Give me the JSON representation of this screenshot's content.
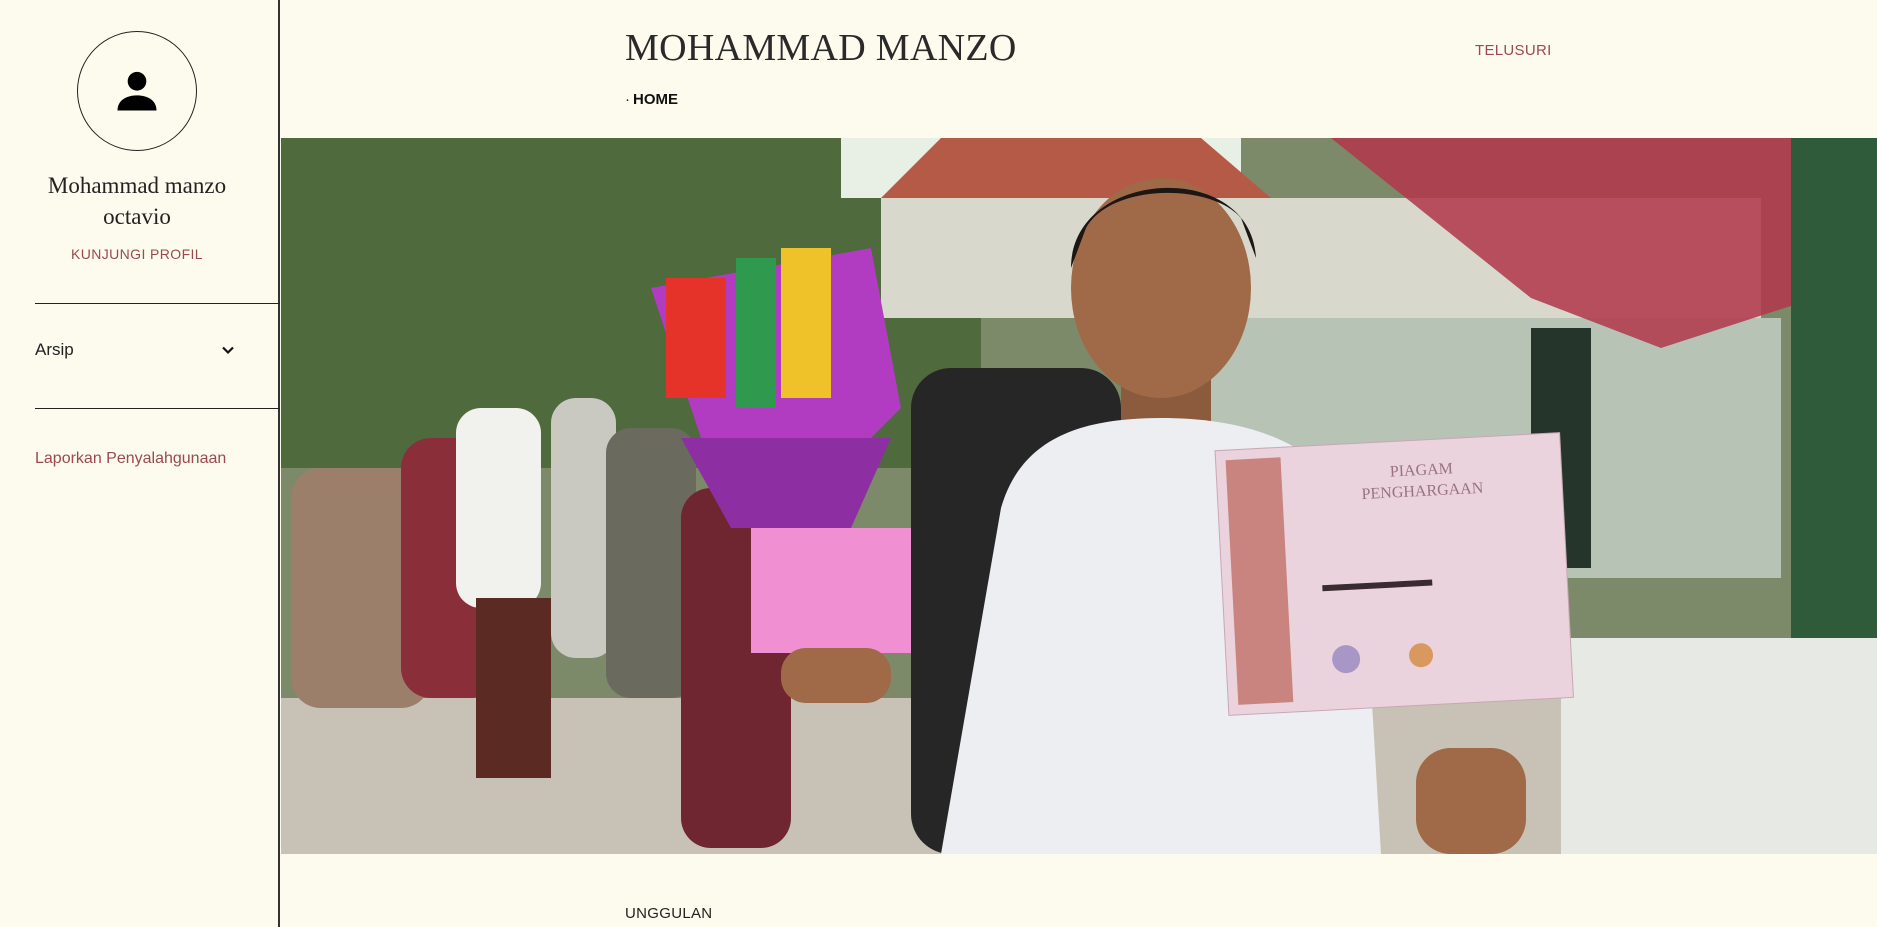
{
  "sidebar": {
    "profile_name": "Mohammad manzo octavio",
    "visit_profile_label": "KUNJUNGI PROFIL",
    "archive_label": "Arsip",
    "report_label": "Laporkan Penyalahgunaan"
  },
  "header": {
    "blog_title": "MOHAMMAD MANZO",
    "breadcrumb_separator": "·",
    "breadcrumb_home": "HOME",
    "explore_label": "TELUSURI"
  },
  "hero": {
    "certificate_title_line1": "PIAGAM",
    "certificate_title_line2": "PENGHARGAAN"
  },
  "main": {
    "featured_label": "UNGGULAN"
  },
  "icons": {
    "avatar": "person-icon",
    "archive_toggle": "chevron-down-icon"
  },
  "colors": {
    "background": "#fdfaee",
    "accent": "#9a4a4f",
    "text": "#222222"
  }
}
